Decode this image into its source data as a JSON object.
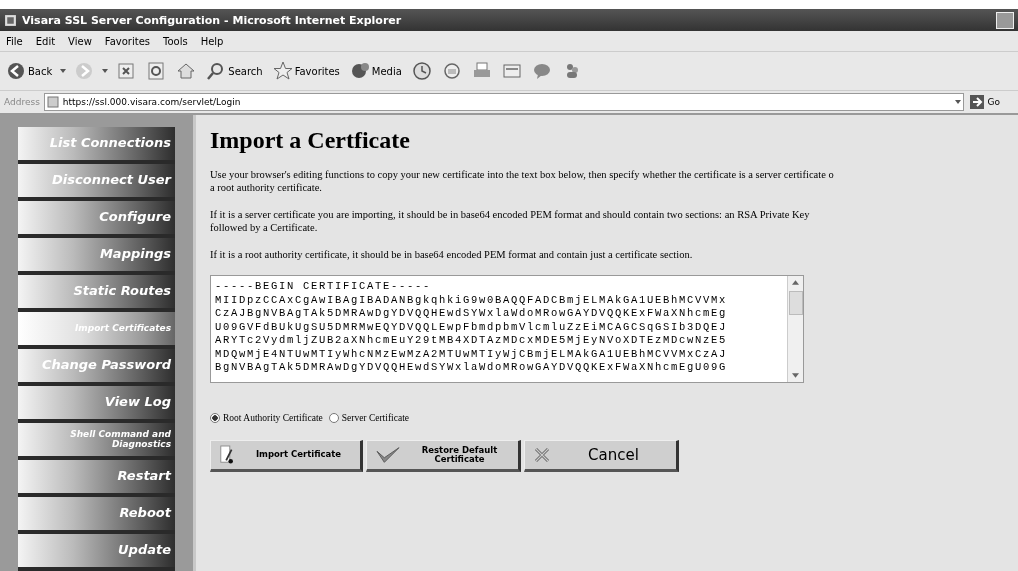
{
  "window": {
    "title": "Visara SSL Server Configuration - Microsoft Internet Explorer"
  },
  "menu": [
    "File",
    "Edit",
    "View",
    "Favorites",
    "Tools",
    "Help"
  ],
  "toolbar": [
    {
      "kind": "back",
      "label": "Back"
    },
    {
      "kind": "forward"
    },
    {
      "kind": "stop"
    },
    {
      "kind": "refresh"
    },
    {
      "kind": "home"
    },
    {
      "kind": "search",
      "label": "Search"
    },
    {
      "kind": "favorites",
      "label": "Favorites"
    },
    {
      "kind": "media",
      "label": "Media"
    },
    {
      "kind": "history"
    },
    {
      "kind": "mail"
    },
    {
      "kind": "print"
    },
    {
      "kind": "edit"
    },
    {
      "kind": "discuss"
    },
    {
      "kind": "messenger"
    }
  ],
  "address": {
    "label": "Address",
    "value": "https://ssl.000.visara.com/servlet/Login",
    "go": "Go"
  },
  "sidebar": [
    {
      "label": "List Connections",
      "selected": false
    },
    {
      "label": "Disconnect User",
      "selected": false
    },
    {
      "label": "Configure",
      "selected": false
    },
    {
      "label": "Mappings",
      "selected": false
    },
    {
      "label": "Static Routes",
      "selected": false
    },
    {
      "label": "Import Certificates",
      "selected": true
    },
    {
      "label": "Change Password",
      "selected": false
    },
    {
      "label": "View Log",
      "selected": false
    },
    {
      "label": "Shell Command and Diagnostics",
      "selected": false
    },
    {
      "label": "Restart",
      "selected": false
    },
    {
      "label": "Reboot",
      "selected": false
    },
    {
      "label": "Update",
      "selected": false
    }
  ],
  "heading": "Import a Certficate",
  "paragraphs": [
    [
      "Use your browser's editing functions to copy your new certificate into the text box below, then specify whether the certificate is a server certificate o",
      "a root authority certificate."
    ],
    [
      "If it is a server certificate you are importing, it should be in base64 encoded PEM format and should contain two sections: an RSA Private Key",
      "followed by a Certificate."
    ],
    [
      "If it is a root authority certificate, it should be in base64 encoded PEM format and contain just a certificate section."
    ]
  ],
  "certificate": "-----BEGIN CERTIFICATE-----\nMIIDpzCCAxCgAwIBAgIBADANBgkqhkiG9w0BAQQFADCBmjELMAkGA1UEBhMCVVMx\nCzAJBgNVBAgTAk5DMRAwDgYDVQQHEwdSYWxlaWdoMRowGAYDVQQKExFWaXNhcmEg\nU09GVFdBUkUgSU5DMRMwEQYDVQQLEwpFbmdpbmVlcmluZzEiMCAGCSqGSIb3DQEJ\nARYTc2VydmljZUB2aXNhcmEuY29tMB4XDTAzMDcxMDE5MjEyNVoXDTEzMDcwNzE5\nMDQwMjE4NTUwMTIyWhcNMzEwMzA2MTUwMTIyWjCBmjELMAkGA1UEBhMCVVMxCzAJ\nBgNVBAgTAk5DMRAwDgYDVQQHEwdSYWxlaWdoMRowGAYDVQQKExFWaXNhcmEgU09G",
  "radios": [
    {
      "label": "Root Authority Certificate",
      "selected": true
    },
    {
      "label": "Server Certificate",
      "selected": false
    }
  ],
  "buttons": [
    {
      "kind": "import",
      "label": "Import Certificate"
    },
    {
      "kind": "restore",
      "label": "Restore Default Certificate"
    },
    {
      "kind": "cancel",
      "label": "Cancel"
    }
  ]
}
